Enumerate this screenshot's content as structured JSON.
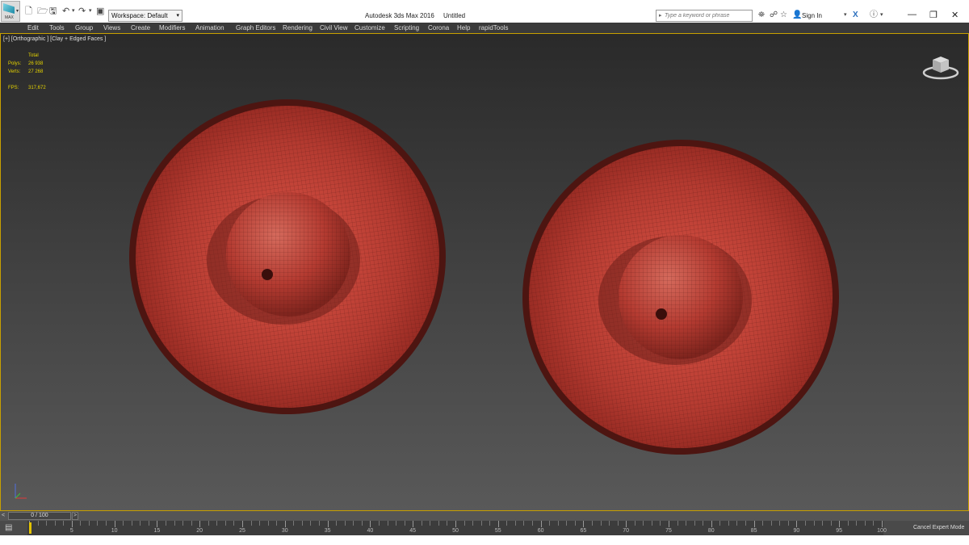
{
  "titlebar": {
    "app_logo_label": "MAX",
    "workspace": "Workspace: Default",
    "app_name": "Autodesk 3ds Max 2016",
    "doc_name": "Untitled",
    "search_placeholder": "Type a keyword or phrase",
    "sign_in": "Sign In"
  },
  "menu": [
    "Edit",
    "Tools",
    "Group",
    "Views",
    "Create",
    "Modifiers",
    "Animation",
    "Graph Editors",
    "Rendering",
    "Civil View",
    "Customize",
    "Scripting",
    "Corona",
    "Help",
    "rapidTools"
  ],
  "viewport": {
    "label": "[+] [Orthographic ] [Clay + Edged Faces ]",
    "stats": {
      "header": "Total",
      "polys_label": "Polys:",
      "polys": "26 938",
      "verts_label": "Verts:",
      "verts": "27 268",
      "fps_label": "FPS:",
      "fps": "317,672"
    }
  },
  "timeline": {
    "slider_label": "0 / 100",
    "prev": "<",
    "next": ">",
    "ticks": [
      "5",
      "10",
      "15",
      "20",
      "25",
      "30",
      "35",
      "40",
      "45",
      "50",
      "55",
      "60",
      "65",
      "70",
      "75",
      "80",
      "85",
      "90",
      "95",
      "100"
    ],
    "cancel_expert": "Cancel Expert Mode"
  },
  "colors": {
    "viewport_border": "#c8a000",
    "stats_text": "#e5d300",
    "clay_red": "#b83a30",
    "playhead": "#e3c300"
  }
}
